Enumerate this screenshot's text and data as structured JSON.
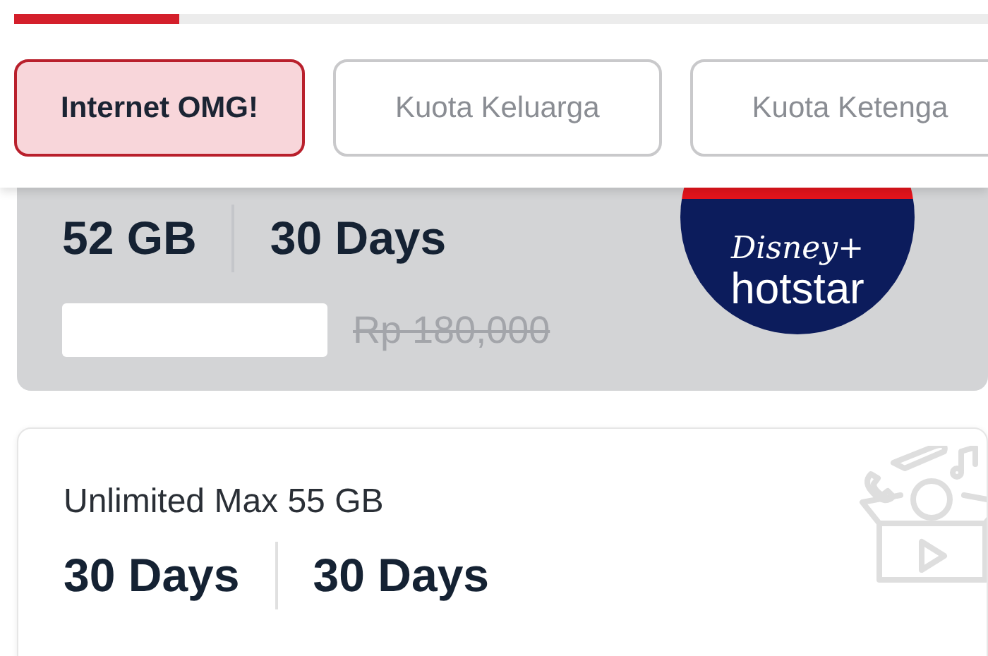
{
  "progress": {
    "level": 0.17
  },
  "tabs": [
    {
      "label": "Internet OMG!",
      "selected": true
    },
    {
      "label": "Kuota Keluarga",
      "selected": false
    },
    {
      "label": "Kuota Ketenga",
      "selected": false
    }
  ],
  "packages": [
    {
      "kind": "featured",
      "specs": [
        "52 GB",
        "30 Days"
      ],
      "old_price": "Rp 180,000",
      "logo": {
        "line_1": "Disney+",
        "line_2": "hotstar"
      }
    },
    {
      "kind": "plain",
      "title": "Unlimited Max 55 GB",
      "specs": [
        "30 Days",
        "30 Days"
      ]
    }
  ]
}
